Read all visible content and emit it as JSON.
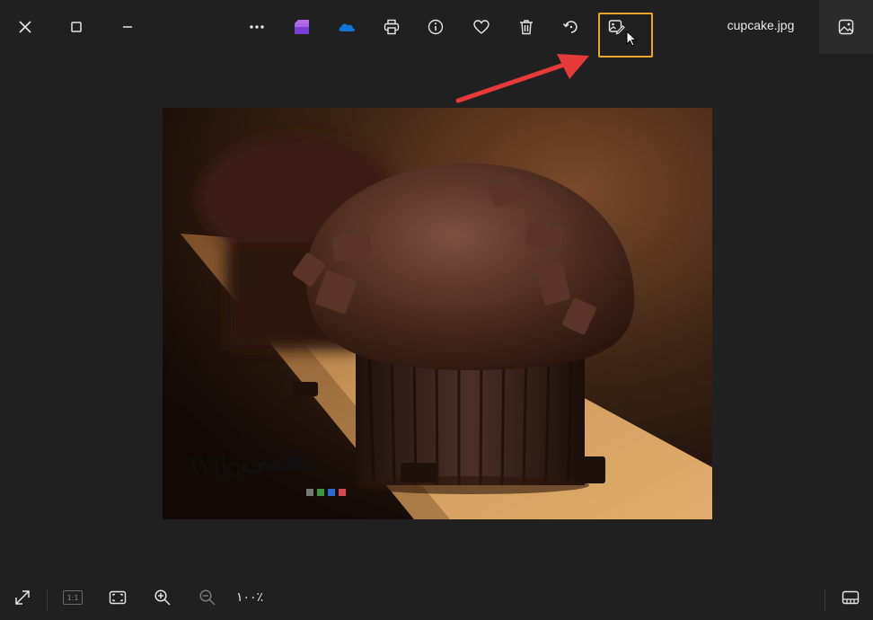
{
  "window": {
    "filename": "cupcake.jpg"
  },
  "toolbar": {
    "icons": [
      "close-icon",
      "maximize-icon",
      "minimize-icon",
      "more-icon",
      "clipchamp-icon",
      "onedrive-icon",
      "print-icon",
      "info-icon",
      "heart-icon",
      "delete-icon",
      "rotate-icon",
      "edit-image-icon",
      "filmstrip-icon"
    ]
  },
  "watermark": {
    "latin": "Wiki",
    "arabic": "تقني"
  },
  "bottombar": {
    "zoom_level": "١٠٠٪",
    "actual_size_label": "1:1"
  },
  "colors": {
    "background": "#202020",
    "highlight": "#e8a92b",
    "arrow": "#e63a3a",
    "onedrive": "#0f78d4"
  }
}
